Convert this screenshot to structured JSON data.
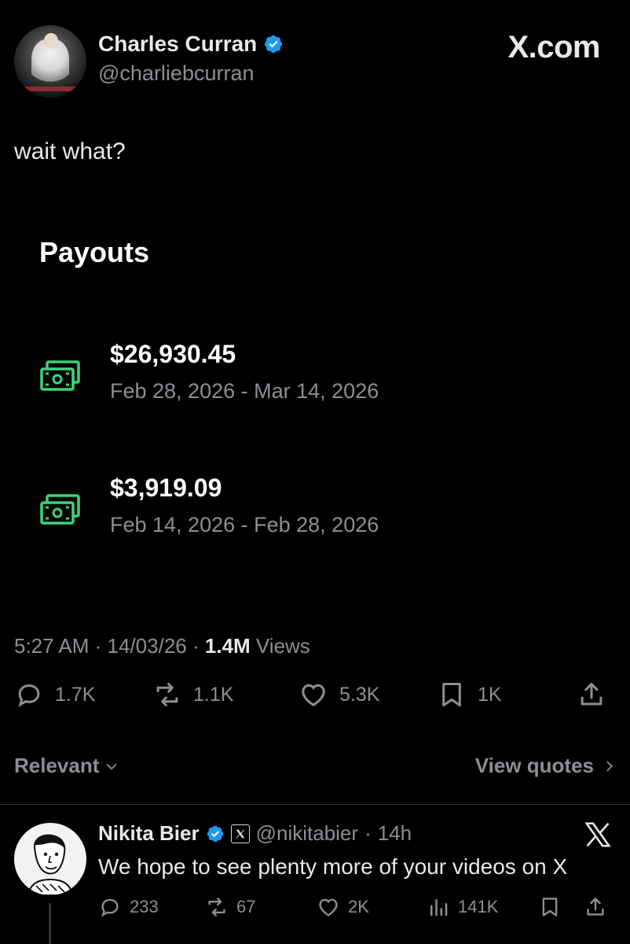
{
  "author": {
    "name": "Charles Curran",
    "handle": "@charliebcurran"
  },
  "brand": "X.com",
  "tweet": {
    "text": "wait what?"
  },
  "payouts": {
    "title": "Payouts",
    "items": [
      {
        "amount": "$26,930.45",
        "range": "Feb 28, 2026 - Mar 14, 2026"
      },
      {
        "amount": "$3,919.09",
        "range": "Feb 14, 2026 - Feb 28, 2026"
      }
    ]
  },
  "meta": {
    "time": "5:27 AM",
    "date": "14/03/26",
    "views_count": "1.4M",
    "views_label": "Views"
  },
  "actions": {
    "replies": "1.7K",
    "reposts": "1.1K",
    "likes": "5.3K",
    "bookmarks": "1K"
  },
  "sort": {
    "relevant": "Relevant",
    "view_quotes": "View quotes"
  },
  "reply": {
    "name": "Nikita Bier",
    "handle": "@nikitabier",
    "age": "14h",
    "text": "We hope to see plenty more of your videos on X",
    "replies": "233",
    "reposts": "67",
    "likes": "2K",
    "views": "141K"
  },
  "colors": {
    "background": "#000000",
    "verified": "#1d9bf0",
    "money_icon": "#3fd17a",
    "muted_text": "#8b8f94"
  }
}
